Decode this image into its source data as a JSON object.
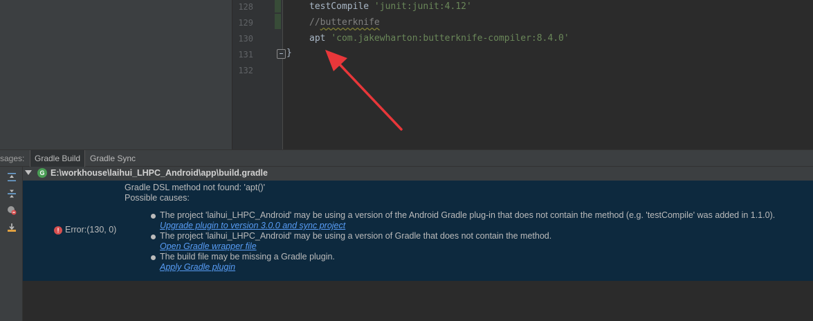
{
  "editor": {
    "line_numbers": [
      "128",
      "129",
      "130",
      "131",
      "132"
    ],
    "lines": {
      "l128_kw": "testCompile ",
      "l128_str": "'junit:junit:4.12'",
      "l129_prefix": "//",
      "l129_word": "butterknife",
      "l130_kw": "apt ",
      "l130_str": "'com.jakewharton:butterknife-compiler:8.4.0'",
      "l131": "}"
    }
  },
  "tabs": {
    "lead": "sages:",
    "gradle_build": "Gradle Build",
    "gradle_sync": "Gradle Sync"
  },
  "tree": {
    "gradle_badge": "G",
    "file_path": "E:\\workhouse\\laihui_LHPC_Android\\app\\build.gradle"
  },
  "error": {
    "badge": "!",
    "label": "Error:(130, 0)",
    "title": "Gradle DSL method not found: 'apt()'",
    "possible_causes": "Possible causes:",
    "causes": [
      {
        "text": "The project 'laihui_LHPC_Android' may be using a version of the Android Gradle plug-in that does not contain the method (e.g. 'testCompile' was added in 1.1.0).",
        "link": "Upgrade plugin to version 3.0.0 and sync project"
      },
      {
        "text": "The project 'laihui_LHPC_Android' may be using a version of Gradle that does not contain the method.",
        "link": "Open Gradle wrapper file"
      },
      {
        "text": "The build file may be missing a Gradle plugin.",
        "link": "Apply Gradle plugin"
      }
    ]
  },
  "colors": {
    "editor_bg": "#2b2b2b",
    "panel_bg": "#3c3f41",
    "error_highlight": "#0d293e",
    "link": "#589df6",
    "arrow": "#e8373a",
    "string": "#6a8759",
    "comment": "#808080"
  },
  "icons": [
    "scroll-to-top-icon",
    "collapse-all-icon",
    "filter-errors-icon",
    "export-icon",
    "gradle-icon",
    "error-icon",
    "fold-marker-icon",
    "annotation-arrow"
  ]
}
